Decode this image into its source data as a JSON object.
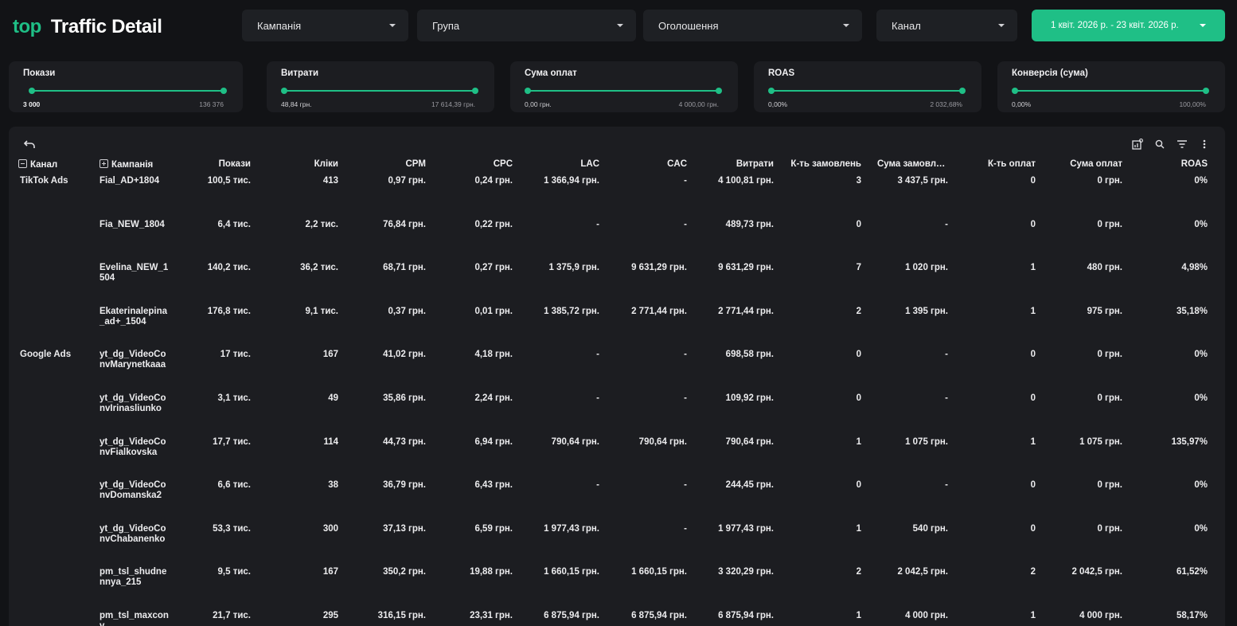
{
  "header": {
    "logo": "top",
    "title": "Traffic Detail",
    "filters": {
      "campaign": "Кампанія",
      "group": "Група",
      "ad": "Оголошення",
      "channel": "Канал",
      "date_range": "1 квіт. 2026 р. - 23 квіт. 2026 р."
    }
  },
  "range_filters": [
    {
      "label": "Покази",
      "min": "3 000",
      "max": "136 376"
    },
    {
      "label": "Витрати",
      "min": "48,84 грн.",
      "max": "17 614,39 грн."
    },
    {
      "label": "Сума оплат",
      "min": "0,00 грн.",
      "max": "4 000,00 грн."
    },
    {
      "label": "ROAS",
      "min": "0,00%",
      "max": "2 032,68%"
    },
    {
      "label": "Конверсія (сума)",
      "min": "0,00%",
      "max": "100,00%"
    }
  ],
  "table": {
    "columns": [
      "Канал",
      "Кампанія",
      "Покази",
      "Кліки",
      "CPM",
      "CPC",
      "LAC",
      "CAC",
      "Витрати",
      "К-ть замовлень",
      "Сума замовле...",
      "К-ть оплат",
      "Сума оплат",
      "ROAS"
    ],
    "rows": [
      {
        "channel": "TikTok Ads",
        "campaign": "Fial_AD+1804",
        "shows": "100,5 тис.",
        "clicks": "413",
        "cpm": "0,97 грн.",
        "cpc": "0,24 грн.",
        "lac": "1 366,94 грн.",
        "cac": "-",
        "spend": "4 100,81 грн.",
        "orders": "3",
        "orders_sum": "3 437,5 грн.",
        "payments": "0",
        "payments_sum": "0 грн.",
        "roas": "0%"
      },
      {
        "channel": "",
        "campaign": "Fia_NEW_1804",
        "shows": "6,4 тис.",
        "clicks": "2,2 тис.",
        "cpm": "76,84 грн.",
        "cpc": "0,22 грн.",
        "lac": "-",
        "cac": "-",
        "spend": "489,73 грн.",
        "orders": "0",
        "orders_sum": "-",
        "payments": "0",
        "payments_sum": "0 грн.",
        "roas": "0%"
      },
      {
        "channel": "",
        "campaign": "Evelina_NEW_1504",
        "shows": "140,2 тис.",
        "clicks": "36,2 тис.",
        "cpm": "68,71 грн.",
        "cpc": "0,27 грн.",
        "lac": "1 375,9 грн.",
        "cac": "9 631,29 грн.",
        "spend": "9 631,29 грн.",
        "orders": "7",
        "orders_sum": "1 020 грн.",
        "payments": "1",
        "payments_sum": "480 грн.",
        "roas": "4,98%"
      },
      {
        "channel": "",
        "campaign": "Ekaterinalepina_ad+_1504",
        "shows": "176,8 тис.",
        "clicks": "9,1 тис.",
        "cpm": "0,37 грн.",
        "cpc": "0,01 грн.",
        "lac": "1 385,72 грн.",
        "cac": "2 771,44 грн.",
        "spend": "2 771,44 грн.",
        "orders": "2",
        "orders_sum": "1 395 грн.",
        "payments": "1",
        "payments_sum": "975 грн.",
        "roas": "35,18%"
      },
      {
        "channel": "Google Ads",
        "campaign": "yt_dg_VideoConvMarynetkaaa",
        "shows": "17 тис.",
        "clicks": "167",
        "cpm": "41,02 грн.",
        "cpc": "4,18 грн.",
        "lac": "-",
        "cac": "-",
        "spend": "698,58 грн.",
        "orders": "0",
        "orders_sum": "-",
        "payments": "0",
        "payments_sum": "0 грн.",
        "roas": "0%"
      },
      {
        "channel": "",
        "campaign": "yt_dg_VideoConvIrinasliunko",
        "shows": "3,1 тис.",
        "clicks": "49",
        "cpm": "35,86 грн.",
        "cpc": "2,24 грн.",
        "lac": "-",
        "cac": "-",
        "spend": "109,92 грн.",
        "orders": "0",
        "orders_sum": "-",
        "payments": "0",
        "payments_sum": "0 грн.",
        "roas": "0%"
      },
      {
        "channel": "",
        "campaign": "yt_dg_VideoConvFialkovska",
        "shows": "17,7 тис.",
        "clicks": "114",
        "cpm": "44,73 грн.",
        "cpc": "6,94 грн.",
        "lac": "790,64 грн.",
        "cac": "790,64 грн.",
        "spend": "790,64 грн.",
        "orders": "1",
        "orders_sum": "1 075 грн.",
        "payments": "1",
        "payments_sum": "1 075 грн.",
        "roas": "135,97%"
      },
      {
        "channel": "",
        "campaign": "yt_dg_VideoConvDomanska2",
        "shows": "6,6 тис.",
        "clicks": "38",
        "cpm": "36,79 грн.",
        "cpc": "6,43 грн.",
        "lac": "-",
        "cac": "-",
        "spend": "244,45 грн.",
        "orders": "0",
        "orders_sum": "-",
        "payments": "0",
        "payments_sum": "0 грн.",
        "roas": "0%"
      },
      {
        "channel": "",
        "campaign": "yt_dg_VideoConvChabanenko",
        "shows": "53,3 тис.",
        "clicks": "300",
        "cpm": "37,13 грн.",
        "cpc": "6,59 грн.",
        "lac": "1 977,43 грн.",
        "cac": "-",
        "spend": "1 977,43 грн.",
        "orders": "1",
        "orders_sum": "540 грн.",
        "payments": "0",
        "payments_sum": "0 грн.",
        "roas": "0%"
      },
      {
        "channel": "",
        "campaign": "pm_tsl_shudnennya_215",
        "shows": "9,5 тис.",
        "clicks": "167",
        "cpm": "350,2 грн.",
        "cpc": "19,88 грн.",
        "lac": "1 660,15 грн.",
        "cac": "1 660,15 грн.",
        "spend": "3 320,29 грн.",
        "orders": "2",
        "orders_sum": "2 042,5 грн.",
        "payments": "2",
        "payments_sum": "2 042,5 грн.",
        "roas": "61,52%"
      },
      {
        "channel": "",
        "campaign": "pm_tsl_maxconv",
        "shows": "21,7 тис.",
        "clicks": "295",
        "cpm": "316,15 грн.",
        "cpc": "23,31 грн.",
        "lac": "6 875,94 грн.",
        "cac": "6 875,94 грн.",
        "spend": "6 875,94 грн.",
        "orders": "1",
        "orders_sum": "4 000 грн.",
        "payments": "1",
        "payments_sum": "4 000 грн.",
        "roas": "58,17%"
      }
    ]
  },
  "icons": {
    "undo": "undo-icon",
    "chart_settings": "chart-settings-icon",
    "search": "zoom-search-icon",
    "filter": "filter-icon",
    "more": "more-vertical-icon"
  },
  "colors": {
    "accent": "#1fbf86",
    "background": "#121316",
    "panel": "#1c1d21"
  }
}
